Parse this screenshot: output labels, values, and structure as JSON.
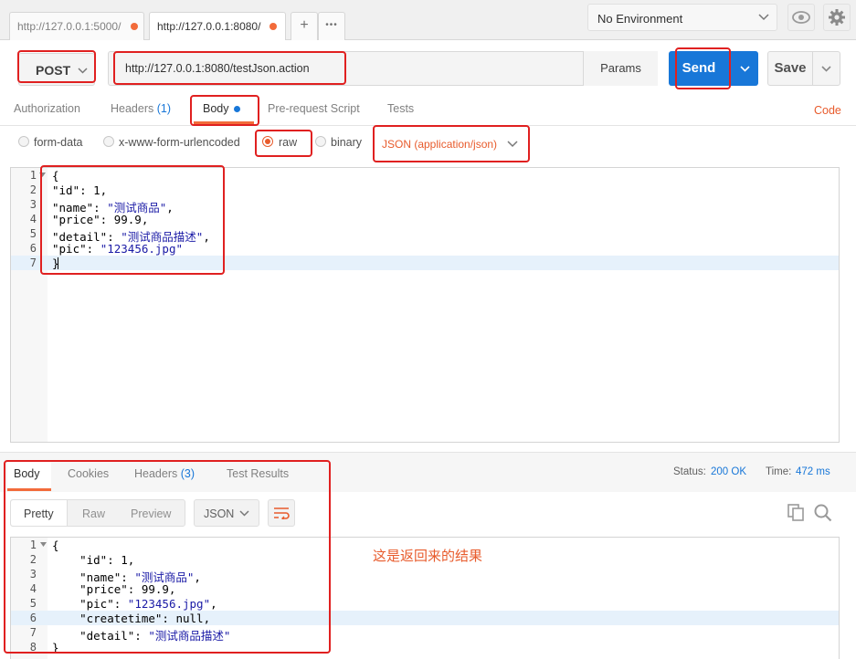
{
  "tabs": [
    {
      "url": "http://127.0.0.1:5000/"
    },
    {
      "url": "http://127.0.0.1:8080/"
    }
  ],
  "tab_controls": {
    "new_tab": "+",
    "more": "•••"
  },
  "environment": {
    "selected": "No Environment"
  },
  "request": {
    "method": "POST",
    "url": "http://127.0.0.1:8080/testJson.action",
    "params_label": "Params",
    "send_label": "Send",
    "save_label": "Save"
  },
  "request_tabs": {
    "authorization": "Authorization",
    "headers": "Headers",
    "headers_count": "(1)",
    "body": "Body",
    "pre_request": "Pre-request Script",
    "tests": "Tests",
    "code": "Code"
  },
  "body_types": {
    "form_data": "form-data",
    "urlencoded": "x-www-form-urlencoded",
    "raw": "raw",
    "binary": "binary",
    "selected": "raw",
    "content_type": "JSON (application/json)"
  },
  "request_body": {
    "line_numbers": [
      "1",
      "2",
      "3",
      "4",
      "5",
      "6",
      "7"
    ],
    "lines": [
      [
        {
          "t": "{"
        }
      ],
      [
        {
          "t": "\"id\": 1,"
        }
      ],
      [
        {
          "t": "\"name\": "
        },
        {
          "t": "\"测试商品\"",
          "s": 1
        },
        {
          "t": ","
        }
      ],
      [
        {
          "t": "\"price\": 99.9,"
        }
      ],
      [
        {
          "t": "\"detail\": "
        },
        {
          "t": "\"测试商品描述\"",
          "s": 1
        },
        {
          "t": ","
        }
      ],
      [
        {
          "t": "\"pic\": "
        },
        {
          "t": "\"123456.jpg\"",
          "s": 1
        }
      ],
      [
        {
          "t": "}"
        }
      ]
    ]
  },
  "response_tabs": {
    "body": "Body",
    "cookies": "Cookies",
    "headers": "Headers",
    "headers_count": "(3)",
    "test_results": "Test Results"
  },
  "response_status": {
    "status_label": "Status:",
    "status_value": "200 OK",
    "time_label": "Time:",
    "time_value": "472 ms"
  },
  "response_view": {
    "pretty": "Pretty",
    "raw": "Raw",
    "preview": "Preview",
    "format": "JSON"
  },
  "response_body": {
    "line_numbers": [
      "1",
      "2",
      "3",
      "4",
      "5",
      "6",
      "7",
      "8"
    ],
    "lines": [
      [
        {
          "t": "{"
        }
      ],
      [
        {
          "t": "    \"id\": 1,"
        }
      ],
      [
        {
          "t": "    \"name\": "
        },
        {
          "t": "\"测试商品\"",
          "s": 1
        },
        {
          "t": ","
        }
      ],
      [
        {
          "t": "    \"price\": 99.9,"
        }
      ],
      [
        {
          "t": "    \"pic\": "
        },
        {
          "t": "\"123456.jpg\"",
          "s": 1
        },
        {
          "t": ","
        }
      ],
      [
        {
          "t": "    \"createtime\": null,"
        }
      ],
      [
        {
          "t": "    \"detail\": "
        },
        {
          "t": "\"测试商品描述\"",
          "s": 1
        }
      ],
      [
        {
          "t": "}"
        }
      ]
    ]
  },
  "annotation": {
    "text": "这是返回来的结果"
  },
  "colors": {
    "accent": "#f26b3a",
    "send": "#1877d8",
    "highlight": "#e02020"
  }
}
